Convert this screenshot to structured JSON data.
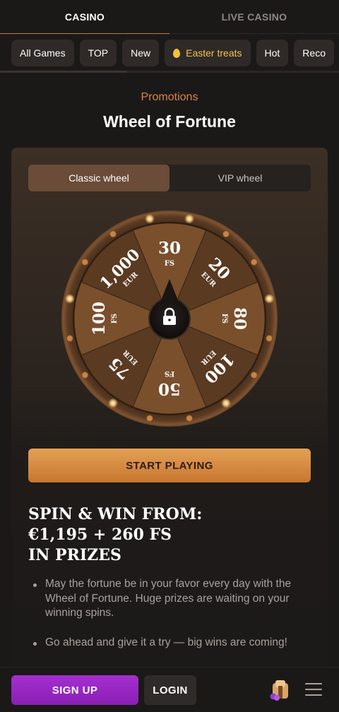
{
  "top_tabs": [
    {
      "label": "CASINO"
    },
    {
      "label": "LIVE CASINO"
    }
  ],
  "chips": [
    {
      "label": "All Games"
    },
    {
      "label": "TOP"
    },
    {
      "label": "New"
    },
    {
      "label": "Easter treats",
      "icon": "easter-egg-icon"
    },
    {
      "label": "Hot"
    },
    {
      "label": "Reco"
    }
  ],
  "promo_label": "Promotions",
  "page_title": "Wheel of Fortune",
  "wheel_tabs": {
    "classic": "Classic wheel",
    "vip": "VIP wheel"
  },
  "wheel": {
    "center_icon": "lock-icon",
    "segments": [
      {
        "value": "30",
        "unit": "FS"
      },
      {
        "value": "20",
        "unit": "EUR"
      },
      {
        "value": "80",
        "unit": "FS"
      },
      {
        "value": "100",
        "unit": "EUR"
      },
      {
        "value": "50",
        "unit": "FS"
      },
      {
        "value": "75",
        "unit": "EUR"
      },
      {
        "value": "100",
        "unit": "FS"
      },
      {
        "value": "1,000",
        "unit": "EUR"
      }
    ]
  },
  "start_button": "START PLAYING",
  "headline": {
    "line1": "SPIN & WIN FROM:",
    "line2": "€1,195 + 260 FS",
    "line3": "IN PRIZES"
  },
  "bullets": [
    "May the fortune be in your favor every day with the Wheel of Fortune. Huge prizes are waiting on your winning spins.",
    "Go ahead and give it a try — big wins are coming!"
  ],
  "bottom": {
    "signup": "SIGN UP",
    "login": "LOGIN",
    "promo_icon": "gift-box-icon",
    "menu_icon": "hamburger-menu-icon"
  },
  "colors": {
    "accent": "#d9834e",
    "start_button": "#d58a3f",
    "signup": "#9a27c4",
    "background": "#1b1918"
  }
}
